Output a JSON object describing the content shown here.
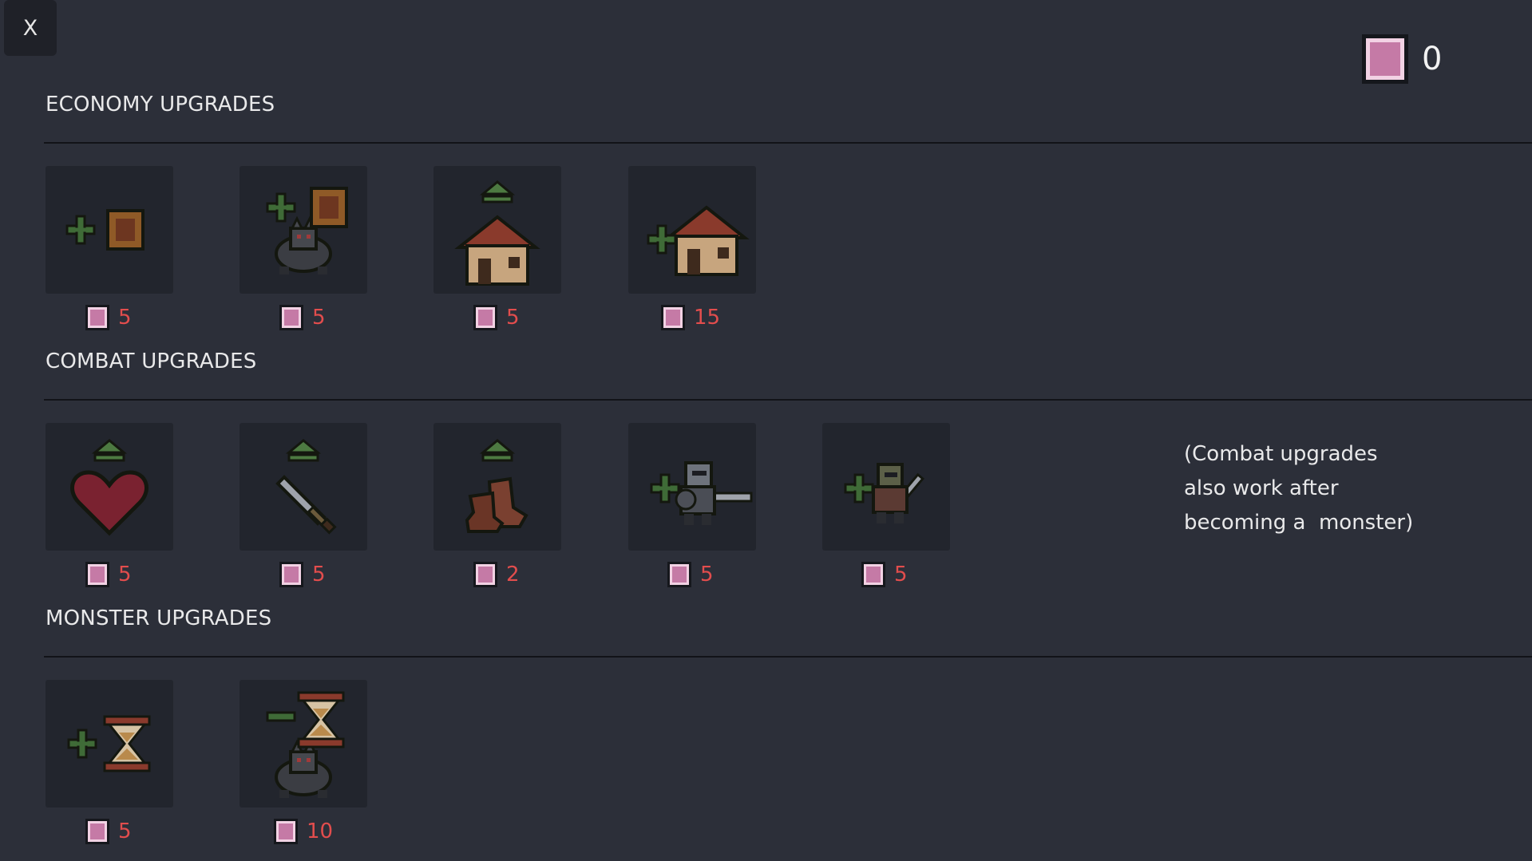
{
  "close_button": {
    "label": "X"
  },
  "currency": {
    "icon": "gem-icon",
    "amount": "0"
  },
  "sections": {
    "economy": {
      "title": "ECONOMY UPGRADES",
      "items": [
        {
          "icon": "add-gold-icon",
          "cost": "5"
        },
        {
          "icon": "add-gold-worker-icon",
          "cost": "5"
        },
        {
          "icon": "upgrade-house-icon",
          "cost": "5"
        },
        {
          "icon": "add-house-icon",
          "cost": "15"
        }
      ]
    },
    "combat": {
      "title": "COMBAT UPGRADES",
      "items": [
        {
          "icon": "upgrade-health-heart-icon",
          "cost": "5"
        },
        {
          "icon": "upgrade-sword-icon",
          "cost": "5"
        },
        {
          "icon": "upgrade-boots-icon",
          "cost": "2"
        },
        {
          "icon": "add-knight-icon",
          "cost": "5"
        },
        {
          "icon": "add-swordsman-icon",
          "cost": "5"
        }
      ],
      "note": "(Combat upgrades\nalso work after\nbecoming a  monster)"
    },
    "monster": {
      "title": "MONSTER UPGRADES",
      "items": [
        {
          "icon": "add-time-hourglass-icon",
          "cost": "5"
        },
        {
          "icon": "reduce-time-monster-icon",
          "cost": "10"
        }
      ]
    }
  },
  "colors": {
    "background": "#2c2f39",
    "card": "#22252d",
    "cost": "#e24d4d",
    "gem": "#c57aa6",
    "plus": "#3f6b37"
  }
}
